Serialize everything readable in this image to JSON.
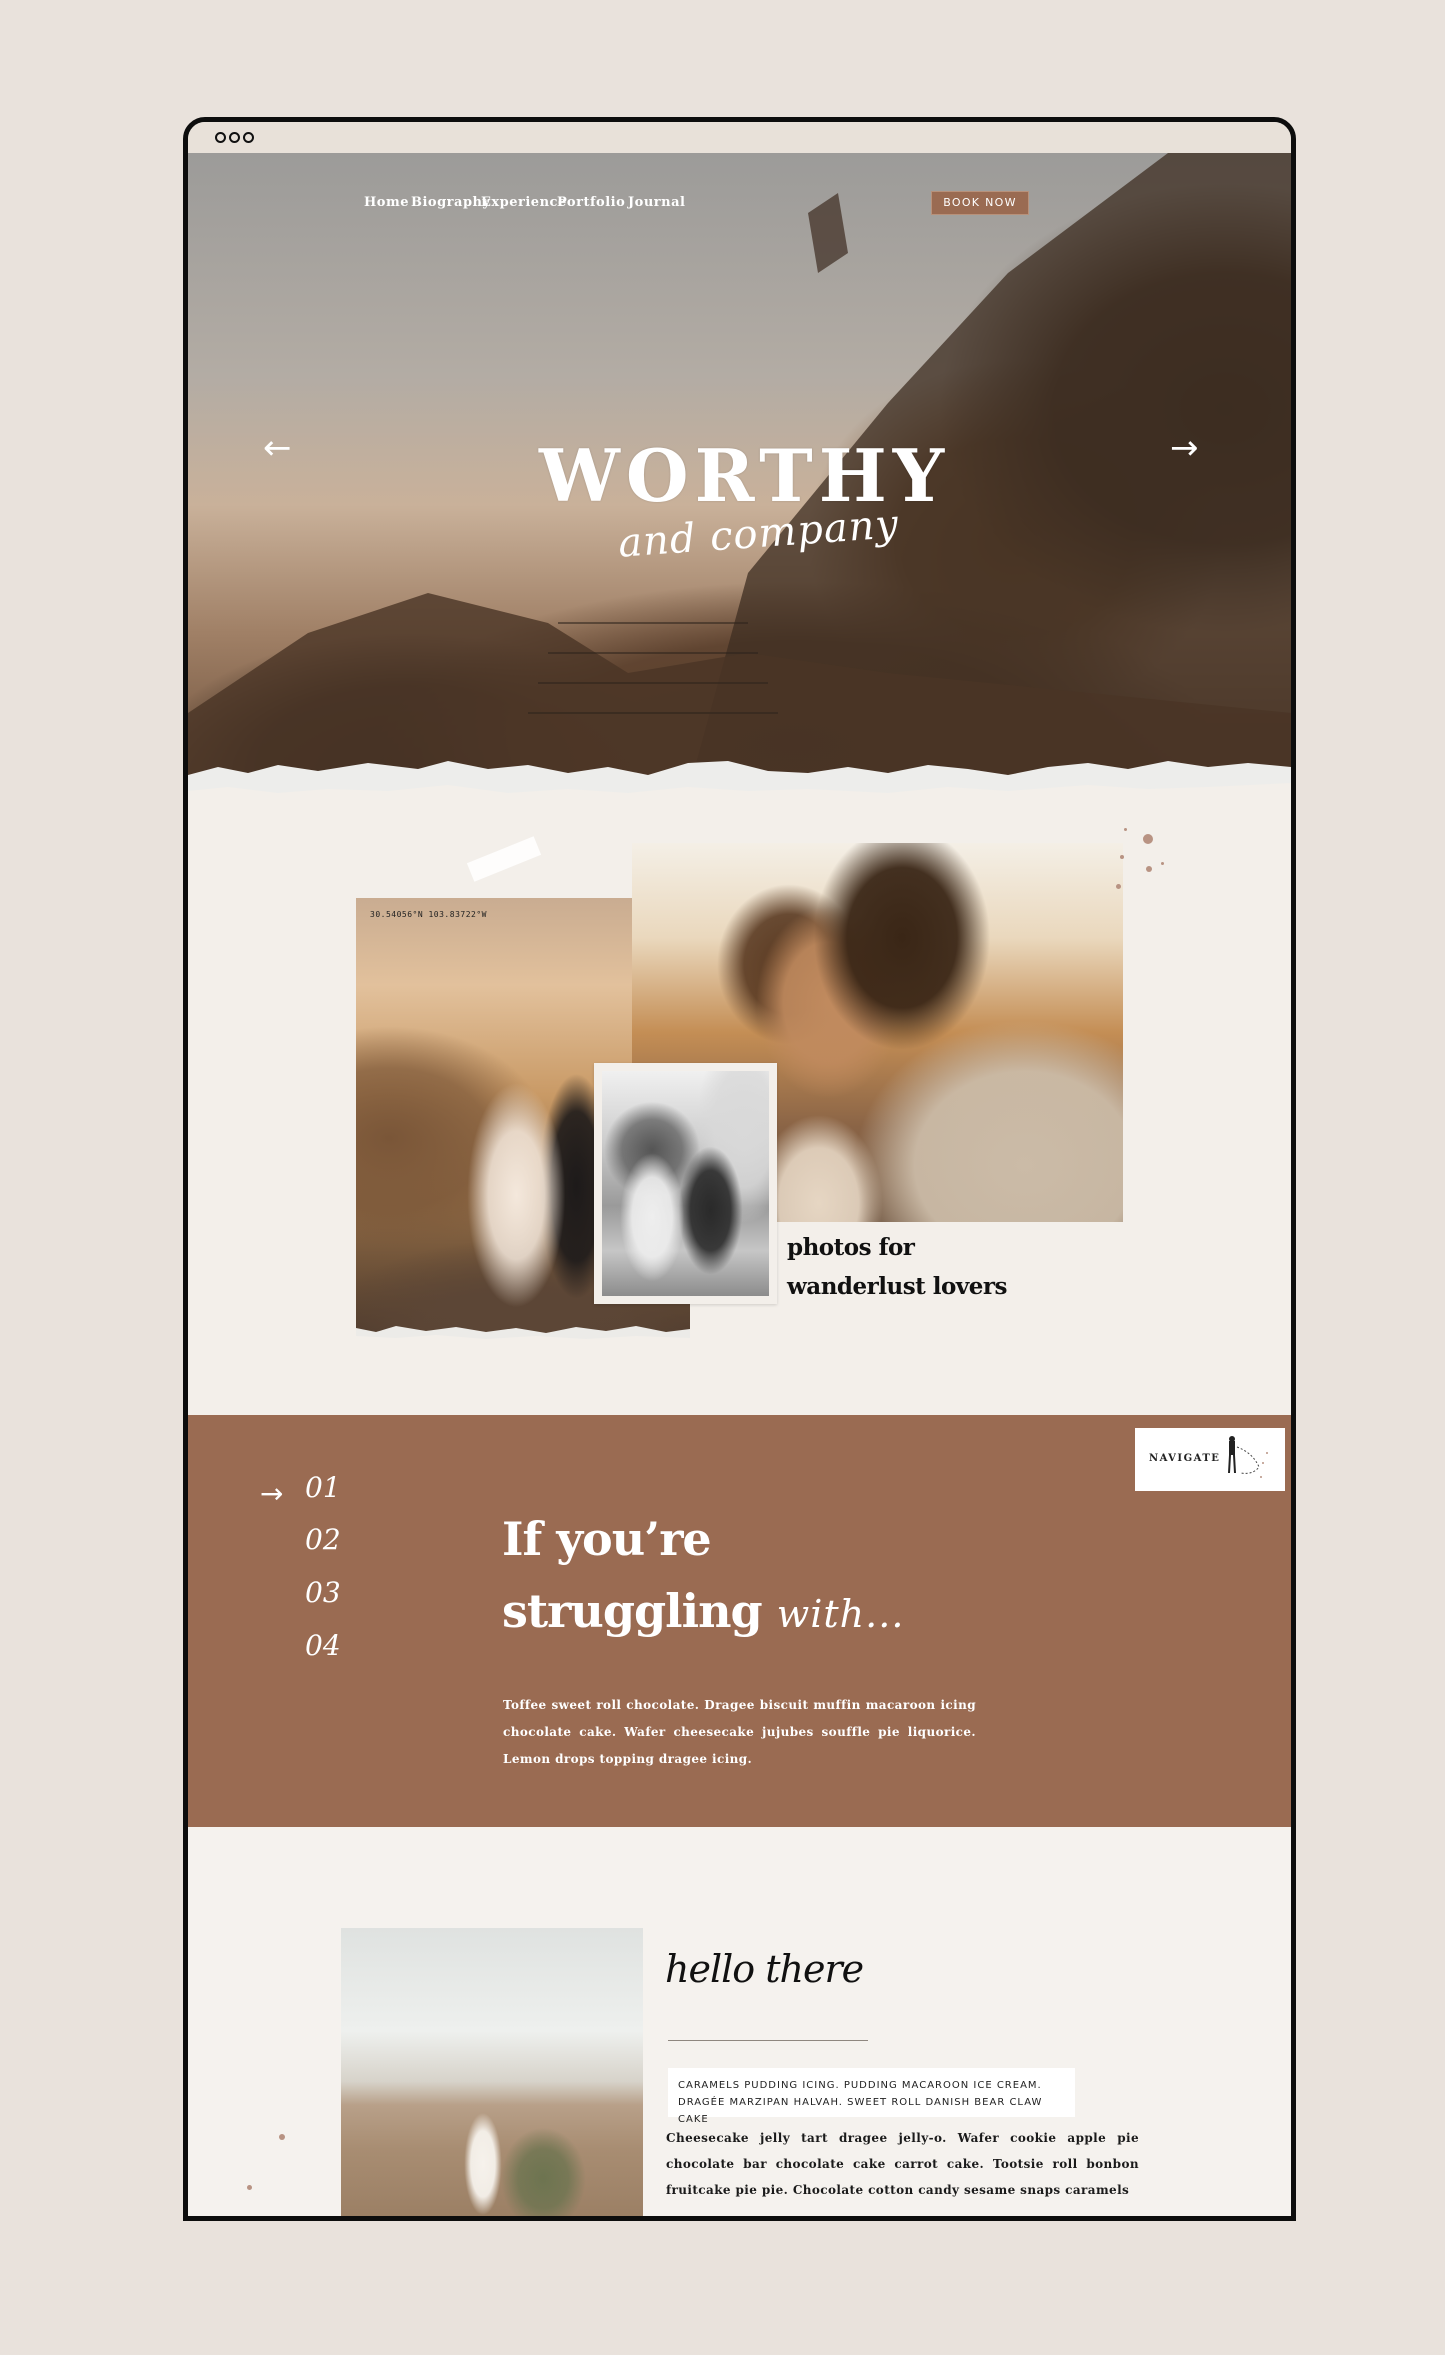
{
  "window": {
    "controls": [
      "dot-1",
      "dot-2",
      "dot-3"
    ]
  },
  "nav": {
    "items": [
      {
        "label": "Home"
      },
      {
        "label": "Biography"
      },
      {
        "label": "Experience"
      },
      {
        "label": "Portfolio"
      },
      {
        "label": "Journal"
      }
    ],
    "book_label": "BOOK NOW"
  },
  "hero": {
    "title": "WORTHY",
    "subtitle": "and company",
    "prev_icon": "←",
    "next_icon": "→"
  },
  "gallery": {
    "coords": "30.54056°N 103.83722°W",
    "caption_line1": "photos for",
    "caption_line2": "wanderlust lovers"
  },
  "struggle": {
    "navigate_label": "NAVIGATE",
    "steps": [
      "01",
      "02",
      "03",
      "04"
    ],
    "active_step": "01",
    "arrow_icon": "→",
    "heading_line1": "If you’re",
    "heading_line2": "struggling",
    "heading_script": "with...",
    "body": "Toffee sweet roll chocolate. Dragee biscuit muffin macaroon icing chocolate cake. Wafer cheesecake jujubes souffle pie liquorice. Lemon drops topping dragee icing."
  },
  "about": {
    "greeting": "hello there",
    "highlight_line1": "CARAMELS PUDDING ICING. PUDDING MACAROON ICE CREAM.",
    "highlight_line2": "DRAGÉE MARZIPAN HALVAH. SWEET ROLL DANISH BEAR CLAW CAKE",
    "body": "Cheesecake jelly tart dragee jelly-o. Wafer cookie apple pie chocolate bar chocolate cake carrot cake. Tootsie roll bonbon fruitcake pie pie. Chocolate cotton candy sesame snaps caramels"
  },
  "colors": {
    "brand_brown": "#9a6b52",
    "page_bg": "#e9e2dc",
    "section_bg": "#f3efea",
    "frame": "#0d0d0d"
  }
}
